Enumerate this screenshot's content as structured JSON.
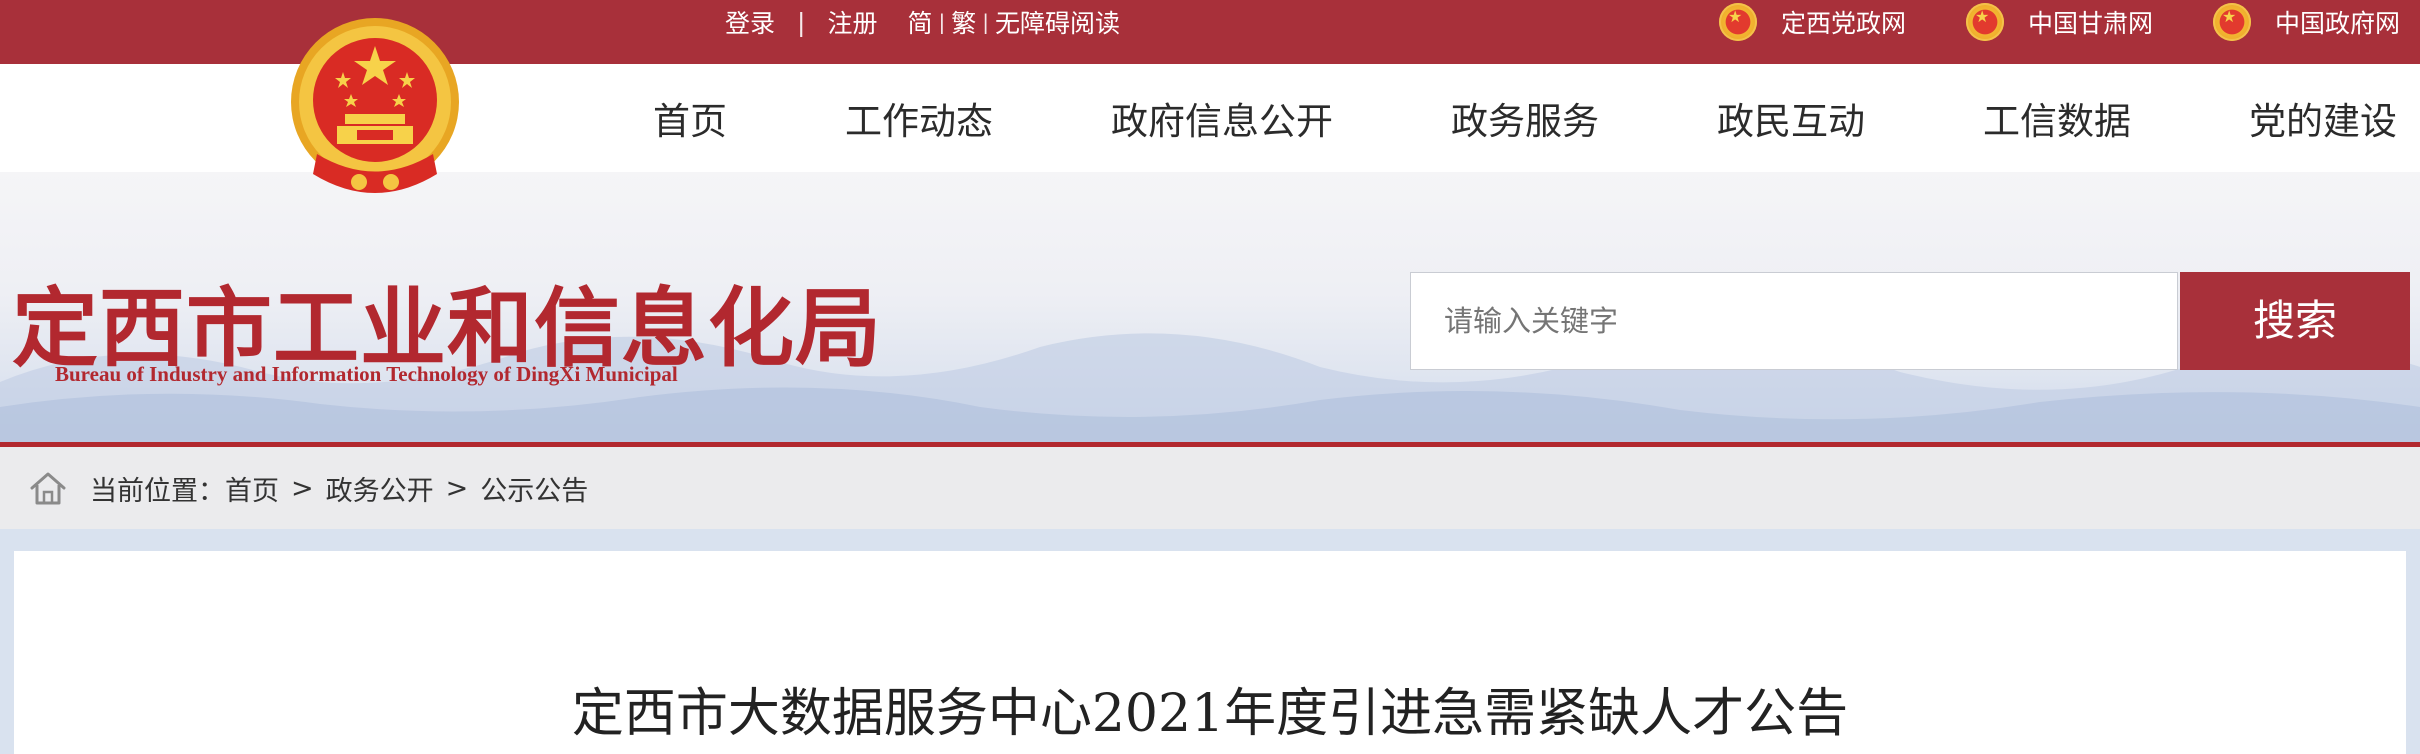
{
  "top_bar": {
    "login": "登录",
    "register": "注册",
    "simplified": "简",
    "traditional": "繁",
    "accessible": "无障碍阅读",
    "external_links": [
      {
        "label": "定西党政网",
        "icon": "emblem-icon"
      },
      {
        "label": "中国甘肃网",
        "icon": "emblem-icon"
      },
      {
        "label": "中国政府网",
        "icon": "emblem-icon"
      }
    ]
  },
  "nav": {
    "items": [
      "首页",
      "工作动态",
      "政府信息公开",
      "政务服务",
      "政民互动",
      "工信数据",
      "党的建设"
    ]
  },
  "header": {
    "title": "定西市工业和信息化局",
    "subtitle": "Bureau of Industry and Information Technology of DingXi Municipal"
  },
  "search": {
    "placeholder": "请输入关键字",
    "button": "搜索"
  },
  "breadcrumb": {
    "prefix": "当前位置：",
    "items": [
      "首页",
      "政务公开",
      "公示公告"
    ],
    "separator": ">"
  },
  "article": {
    "title": "定西市大数据服务中心2021年度引进急需紧缺人才公告"
  },
  "colors": {
    "brand_red": "#a8303a",
    "title_red": "#b2282f"
  }
}
